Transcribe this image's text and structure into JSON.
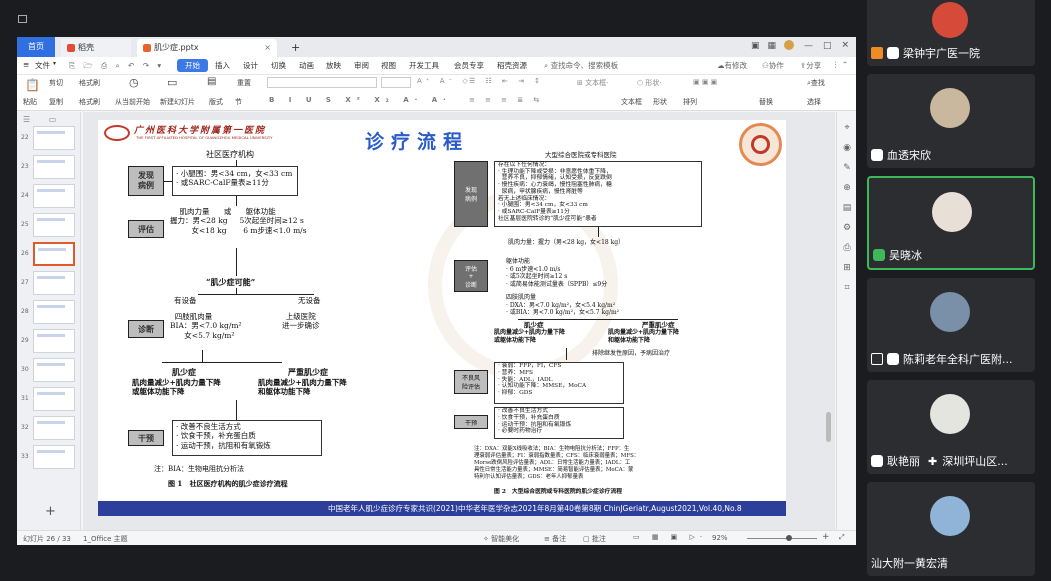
{
  "tabs": {
    "home": "首页",
    "docer": "稻壳",
    "file": "肌少症.pptx",
    "plus": "+"
  },
  "menu": {
    "file": "文件",
    "items": [
      "开始",
      "插入",
      "设计",
      "切换",
      "动画",
      "放映",
      "审阅",
      "视图",
      "开发工具",
      "会员专享",
      "稻壳资源"
    ],
    "search": "查找命令、搜索模板",
    "unsaved": "有修改",
    "collab": "协作",
    "share": "分享"
  },
  "ribbon": {
    "row1": [
      "剪切",
      "格式刷",
      "当页开始",
      "新建幻灯片",
      "版式",
      "节",
      "重置",
      "文本框",
      "形状",
      "图片",
      "排列",
      "查找"
    ],
    "row2": [
      "粘贴",
      "复制",
      "格式刷",
      "从当前开始",
      "新建幻灯片",
      "版式",
      "节",
      "文本框",
      "形状",
      "排列",
      "替换",
      "选择"
    ]
  },
  "thumbnails": [
    {
      "num": "22"
    },
    {
      "num": "23"
    },
    {
      "num": "24"
    },
    {
      "num": "25"
    },
    {
      "num": "26"
    },
    {
      "num": "27"
    },
    {
      "num": "28"
    },
    {
      "num": "29"
    },
    {
      "num": "30"
    },
    {
      "num": "31"
    },
    {
      "num": "32"
    },
    {
      "num": "33"
    }
  ],
  "slide": {
    "title": "诊疗流程",
    "hospital_cn": "广州医科大学附属第一医院",
    "hospital_en": "THE FIRST AFFILIATED HOSPITAL OF GUANGZHOU MEDICAL UNIVERSITY",
    "left": {
      "header": "社区医疗机构",
      "label_detect": "发现\n病例",
      "detect_text": "· 小腿围：男<34 cm，女<33 cm\n· 或SARC-CalF量表≥11分",
      "label_assess": "评估",
      "assess_text": "    肌肉力量      或      躯体功能\n握力：男<28 kg     5次起坐时间≥12 s\n         女<18 kg       6 m步速<1.0 m/s",
      "possible": "“肌少症可能”",
      "has_device": "有设备",
      "no_device": "无设备",
      "label_diag": "诊断",
      "diag_text": "  四肢肌肉量\nBIA：男<7.0 kg/m²\n      女<5.7 kg/m²",
      "referral": "上级医院\n进一步确诊",
      "sarcopenia": "肌少症",
      "sarcopenia_desc": "肌肉量减少+肌肉力量下降\n或躯体功能下降",
      "severe": "严重肌少症",
      "severe_desc": "肌肉量减少+肌肉力量下降\n和躯体功能下降",
      "label_interv": "干预",
      "interv_text": "· 改善不良生活方式\n· 饮食干预，补充蛋白质\n· 运动干预，抗阻和有氧锻炼",
      "note": "注：BIA：生物电阻抗分析法",
      "caption": "图 1   社区医疗机构的肌少症诊疗流程"
    },
    "right": {
      "header": "大型综合医院或专科医院",
      "label_detect": "发现\n病例",
      "detect_text": "存在以下任何情况：\n· 生理功能下降或受损：非意愿性体重下降，\n  营养不良，抑郁情绪，认知受损，反复跌倒\n· 慢性疾病：心力衰竭，慢性阻塞性肺病，糖\n  尿病，甲状腺疾病，慢性肾脏等\n若无上述临床情况：\n· 小腿围：男<34 cm，女<33 cm\n· 或SARC-CalF量表≥11分\n社区基层医院转诊的“肌少症可能”患者",
      "label_assess": "评估\n+\n诊断",
      "strength": "肌肉力量：握力（男<28 kg，女<18 kg）",
      "function": "躯体功能\n· 6 m步速<1.0 m/s\n· 或5次起坐时间≥12 s\n· 或简易体能测试量表（SPPB）≤9分",
      "mass": "四肢肌肉量\n· DXA：男<7.0 kg/m²，女<5.4 kg/m²\n· 或BIA：男<7.0 kg/m²，女<5.7 kg/m²",
      "sarcopenia": "肌少症",
      "sarcopenia_desc": "肌肉量减少+肌肉力量下降\n或躯体功能下降",
      "severe": "严重肌少症",
      "severe_desc": "肌肉量减少+肌肉力量下降\n和躯体功能下降",
      "exclude": "排除继发性原因，予病因治疗",
      "label_risk": "不良风\n险评估",
      "risk_text": "· 衰弱：FFP，FI，CFS\n· 营养：MFS\n· 失能：ADL，IADL\n· 认知功能下降：MMSE，MoCA\n· 抑郁：GDS",
      "label_interv": "干预",
      "interv_text": "· 改善不良生活方式\n· 饮食干预，补充蛋白质\n· 运动干预：抗阻和有氧锻炼\n· 必要时药物治疗",
      "note": "注：DXA：双能X线吸收法；BIA：生物电阻抗分析法；FFP：生\n理衰弱评估量表；FI：衰弱指数量表；CFS：临床衰弱量表；MFS：\nMorse跌倒风险评估量表；ADL：日常生活能力量表；IADL：工\n具性日常生活能力量表；MMSE：简易智能评估量表；MoCA：蒙\n特利尔认知评估量表；GDS：老年人抑郁量表",
      "caption": "图 2   大型综合医院或专科医院的肌少症诊疗流程"
    },
    "footer": "中国老年人肌少症诊疗专家共识(2021)中华老年医学杂志2021年8月第40卷第8期 ChinJGeriatr,August2021,Vol.40,No.8"
  },
  "statusbar": {
    "slide_count": "幻灯片 26 / 33",
    "theme": "1_Office 主题",
    "beautify": "智能美化",
    "notes": "备注",
    "comments": "批注",
    "zoom": "92%"
  },
  "participants": [
    {
      "name": "梁钟宇广医一院",
      "mic": "off"
    },
    {
      "name": "血透宋欣",
      "mic": "off"
    },
    {
      "name": "吴晓冰",
      "mic": "on",
      "active": true
    },
    {
      "name": "陈莉老年全科广医附...",
      "mic": "off"
    },
    {
      "name": "耿艳丽",
      "extra": "深圳坪山区...",
      "mic": "off"
    },
    {
      "name": "汕大附一黄宏清",
      "mic": "none"
    }
  ],
  "colors": {
    "accent": "#2f6fe0",
    "ribbon_active": "#3c78e6",
    "title_blue": "#2a5cc8",
    "logo_red": "#c0392b",
    "speaking_green": "#3fb85a",
    "footer_blue": "#2d3e9b"
  }
}
